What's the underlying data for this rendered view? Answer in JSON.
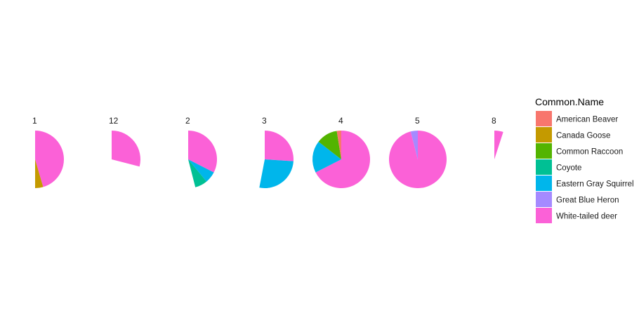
{
  "chart_data": {
    "type": "pie",
    "subtype": "faceted radial bar / coxcomb",
    "legend": {
      "title": "Common.Name",
      "position": "right",
      "entries": [
        {
          "label": "American Beaver",
          "color": "#F8766D"
        },
        {
          "label": "Canada Goose",
          "color": "#C49A00"
        },
        {
          "label": "Common Raccoon",
          "color": "#53B400"
        },
        {
          "label": "Coyote",
          "color": "#00C094"
        },
        {
          "label": "Eastern Gray Squirrel",
          "color": "#00B6EB"
        },
        {
          "label": "Great Blue Heron",
          "color": "#A58AFF"
        },
        {
          "label": "White-tailed deer",
          "color": "#FB61D7"
        }
      ]
    },
    "grid": false,
    "facets": [
      {
        "label": "1",
        "slices": [
          {
            "name": "White-tailed deer",
            "start": 0.0,
            "end": 0.455
          },
          {
            "name": "Canada Goose",
            "start": 0.455,
            "end": 0.5
          }
        ]
      },
      {
        "label": "12",
        "slices": [
          {
            "name": "White-tailed deer",
            "start": 0.0,
            "end": 0.29
          }
        ]
      },
      {
        "label": "2",
        "slices": [
          {
            "name": "White-tailed deer",
            "start": 0.0,
            "end": 0.325
          },
          {
            "name": "Eastern Gray Squirrel",
            "start": 0.325,
            "end": 0.39
          },
          {
            "name": "Coyote",
            "start": 0.39,
            "end": 0.46
          }
        ]
      },
      {
        "label": "3",
        "slices": [
          {
            "name": "White-tailed deer",
            "start": 0.0,
            "end": 0.26
          },
          {
            "name": "Eastern Gray Squirrel",
            "start": 0.26,
            "end": 0.53
          }
        ]
      },
      {
        "label": "4",
        "slices": [
          {
            "name": "White-tailed deer",
            "start": 0.0,
            "end": 0.675
          },
          {
            "name": "Eastern Gray Squirrel",
            "start": 0.675,
            "end": 0.855
          },
          {
            "name": "Common Raccoon",
            "start": 0.855,
            "end": 0.975
          },
          {
            "name": "American Beaver",
            "start": 0.975,
            "end": 1.0
          }
        ]
      },
      {
        "label": "5",
        "slices": [
          {
            "name": "White-tailed deer",
            "start": 0.0,
            "end": 0.96
          },
          {
            "name": "Great Blue Heron",
            "start": 0.96,
            "end": 1.0
          }
        ]
      },
      {
        "label": "8",
        "slices": [
          {
            "name": "White-tailed deer",
            "start": 0.0,
            "end": 0.05
          }
        ]
      }
    ]
  }
}
